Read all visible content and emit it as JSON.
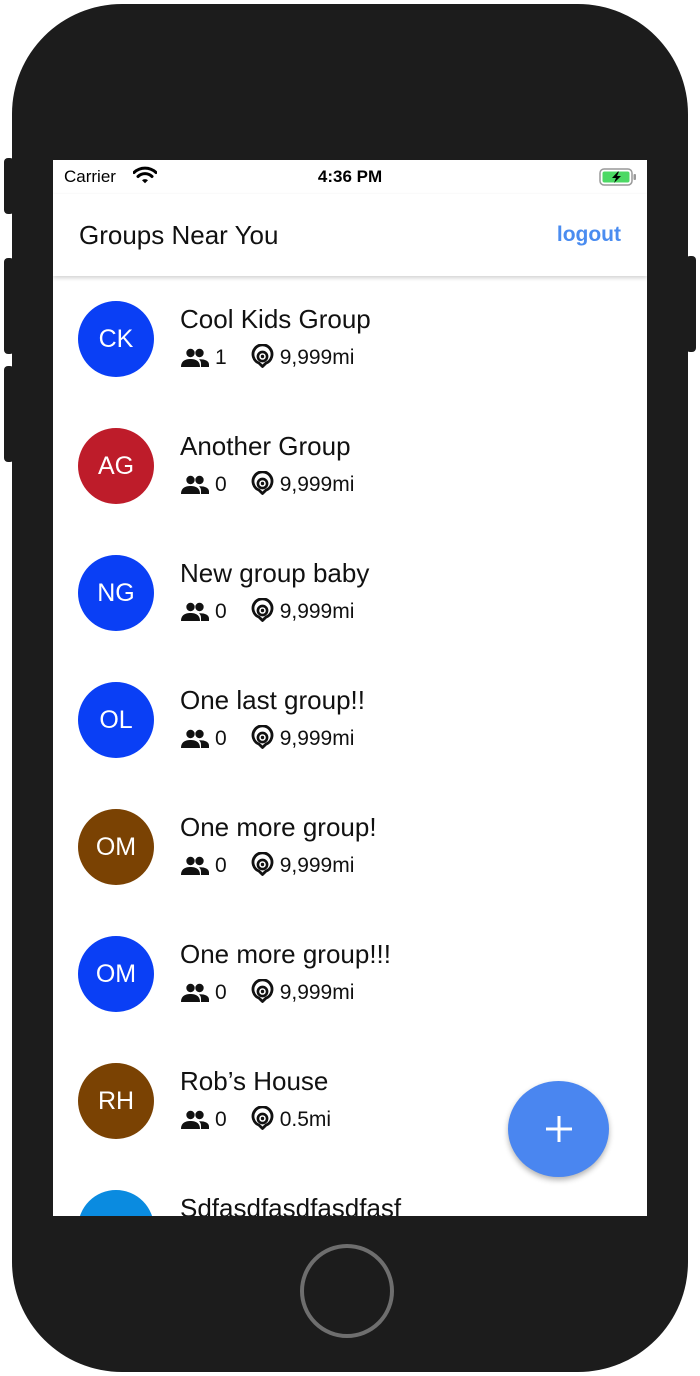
{
  "status_bar": {
    "carrier": "Carrier",
    "time": "4:36 PM"
  },
  "nav": {
    "title": "Groups Near You",
    "logout_label": "logout"
  },
  "groups": [
    {
      "initials": "CK",
      "name": "Cool Kids Group",
      "members": "1",
      "distance": "9,999mi",
      "color": "#0a3ff5"
    },
    {
      "initials": "AG",
      "name": "Another Group",
      "members": "0",
      "distance": "9,999mi",
      "color": "#be1c2a"
    },
    {
      "initials": "NG",
      "name": "New group baby",
      "members": "0",
      "distance": "9,999mi",
      "color": "#0a3ff5"
    },
    {
      "initials": "OL",
      "name": "One last group!!",
      "members": "0",
      "distance": "9,999mi",
      "color": "#0a3ff5"
    },
    {
      "initials": "OM",
      "name": "One more group!",
      "members": "0",
      "distance": "9,999mi",
      "color": "#7a4203"
    },
    {
      "initials": "OM",
      "name": "One more group!!!",
      "members": "0",
      "distance": "9,999mi",
      "color": "#0a3ff5"
    },
    {
      "initials": "RH",
      "name": "Rob’s House",
      "members": "0",
      "distance": "0.5mi",
      "color": "#7a4203"
    },
    {
      "initials": "",
      "name": "Sdfasdfasdfasdfasf",
      "members": "",
      "distance": "",
      "color": "#0a8be0"
    }
  ],
  "fab": {
    "icon": "plus-icon"
  },
  "colors": {
    "accent": "#4a8cf0",
    "fab": "#4a86f0"
  }
}
